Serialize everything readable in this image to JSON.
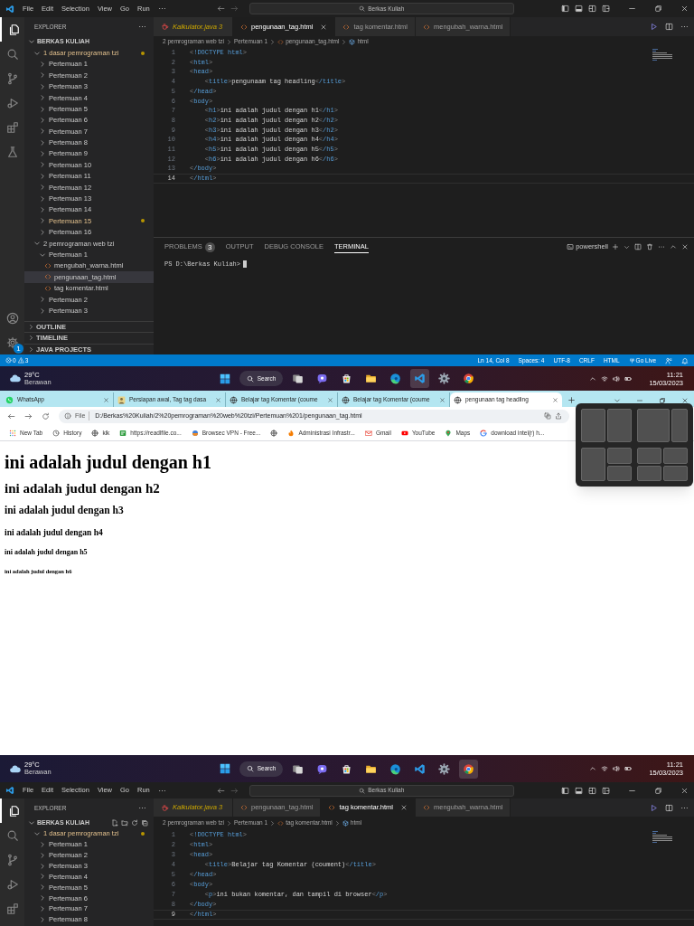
{
  "editor_top": {
    "title_bar": {
      "menu": [
        "File",
        "Edit",
        "Selection",
        "View",
        "Go",
        "Run"
      ],
      "search": "Berkas Kuliah"
    },
    "activity_bar": {
      "items": [
        {
          "kind": "files",
          "selected": true
        },
        {
          "kind": "search",
          "selected": false
        },
        {
          "kind": "source_control",
          "selected": false
        },
        {
          "kind": "run",
          "selected": false
        },
        {
          "kind": "extensions",
          "selected": false
        },
        {
          "kind": "testing",
          "selected": false
        }
      ],
      "bottom_items": [
        {
          "kind": "account"
        },
        {
          "kind": "settings",
          "badge": "1"
        }
      ]
    },
    "explorer": {
      "title": "EXPLORER",
      "root": {
        "label": "BERKAS KULIAH",
        "kind": "folder",
        "expanded": true,
        "actions_shown": false,
        "children": [
          {
            "label": "1 dasar pemrograman tzi",
            "kind": "folder",
            "expanded": true,
            "modified": true,
            "children": [
              {
                "label": "Pertemuan 1",
                "kind": "folder",
                "expanded": false,
                "modified": false
              },
              {
                "label": "Pertemuan 2",
                "kind": "folder",
                "expanded": false,
                "modified": false
              },
              {
                "label": "Pertemuan 3",
                "kind": "folder",
                "expanded": false,
                "modified": false
              },
              {
                "label": "Pertemuan 4",
                "kind": "folder",
                "expanded": false,
                "modified": false
              },
              {
                "label": "Pertemuan 5",
                "kind": "folder",
                "expanded": false,
                "modified": false
              },
              {
                "label": "Pertemuan 6",
                "kind": "folder",
                "expanded": false,
                "modified": false
              },
              {
                "label": "Pertemuan 7",
                "kind": "folder",
                "expanded": false,
                "modified": false
              },
              {
                "label": "Pertemuan 8",
                "kind": "folder",
                "expanded": false,
                "modified": false
              },
              {
                "label": "Pertemuan 9",
                "kind": "folder",
                "expanded": false,
                "modified": false
              },
              {
                "label": "Pertemuan 10",
                "kind": "folder",
                "expanded": false,
                "modified": false
              },
              {
                "label": "Pertemuan 11",
                "kind": "folder",
                "expanded": false,
                "modified": false
              },
              {
                "label": "Pertemuan 12",
                "kind": "folder",
                "expanded": false,
                "modified": false
              },
              {
                "label": "Pertemuan 13",
                "kind": "folder",
                "expanded": false,
                "modified": false
              },
              {
                "label": "Pertemuan 14",
                "kind": "folder",
                "expanded": false,
                "modified": false
              },
              {
                "label": "Pertemuan 15",
                "kind": "folder",
                "expanded": false,
                "modified": true
              },
              {
                "label": "Pertemuan 16",
                "kind": "folder",
                "expanded": false,
                "modified": false
              }
            ]
          },
          {
            "label": "2 pemrograman web tzi",
            "kind": "folder",
            "expanded": true,
            "modified": false,
            "children": [
              {
                "label": "Pertemuan 1",
                "kind": "folder",
                "expanded": true,
                "children": [
                  {
                    "label": "mengubah_warna.html",
                    "kind": "file",
                    "selected": false
                  },
                  {
                    "label": "pengunaan_tag.html",
                    "kind": "file",
                    "selected": true
                  },
                  {
                    "label": "tag komentar.html",
                    "kind": "file",
                    "selected": false
                  }
                ]
              },
              {
                "label": "Pertemuan 2",
                "kind": "folder",
                "expanded": false
              },
              {
                "label": "Pertemuan 3",
                "kind": "folder",
                "expanded": false
              }
            ]
          }
        ]
      },
      "sections": [
        "OUTLINE",
        "TIMELINE",
        "JAVA PROJECTS"
      ]
    },
    "tabs": [
      {
        "label": "Kalkulator.java",
        "kind": "java",
        "badge": "3",
        "selected": false
      },
      {
        "label": "pengunaan_tag.html",
        "kind": "html",
        "selected": true
      },
      {
        "label": "tag komentar.html",
        "kind": "html",
        "selected": false
      },
      {
        "label": "mengubah_warna.html",
        "kind": "html",
        "selected": false
      }
    ],
    "breadcrumb": [
      {
        "label": "2 pemrograman web tzi",
        "kind": "folder"
      },
      {
        "label": "Pertemuan 1",
        "kind": "folder"
      },
      {
        "label": "pengunaan_tag.html",
        "kind": "file"
      },
      {
        "label": "html",
        "kind": "element"
      }
    ],
    "code": [
      {
        "number": "1",
        "text": "<!DOCTYPE html>",
        "current": false
      },
      {
        "number": "2",
        "text": "<html>",
        "current": false
      },
      {
        "number": "3",
        "text": "<head>",
        "current": false
      },
      {
        "number": "4",
        "text": "    <title>pengunaam tag headling</title>",
        "current": false
      },
      {
        "number": "5",
        "text": "</head>",
        "current": false
      },
      {
        "number": "6",
        "text": "<body>",
        "current": false
      },
      {
        "number": "7",
        "text": "    <h1>ini adalah judul dengan h1</h1>",
        "current": false
      },
      {
        "number": "8",
        "text": "    <h2>ini adalah judul dengan h2</h2>",
        "current": false
      },
      {
        "number": "9",
        "text": "    <h3>ini adalah judul dengan h3</h2>",
        "current": false
      },
      {
        "number": "10",
        "text": "    <h4>ini adalah judul dengan h4</h4>",
        "current": false
      },
      {
        "number": "11",
        "text": "    <h5>ini adalah judul dengan h5</h5>",
        "current": false
      },
      {
        "number": "12",
        "text": "    <h6>ini adalah judul dengan h6</h6>",
        "current": false
      },
      {
        "number": "13",
        "text": "</body>",
        "current": false
      },
      {
        "number": "14",
        "text": "</html>",
        "current": true
      }
    ],
    "panel": {
      "tabs": [
        {
          "label": "PROBLEMS",
          "badge": "3",
          "selected": false
        },
        {
          "label": "OUTPUT",
          "selected": false
        },
        {
          "label": "DEBUG CONSOLE",
          "selected": false
        },
        {
          "label": "TERMINAL",
          "selected": true
        }
      ],
      "shell": "powershell",
      "terminal_lines": [
        "PS D:\\Berkas Kuliah>"
      ]
    },
    "status_bar": {
      "errors": "0",
      "warnings": "3",
      "items": [
        {
          "text": "Ln 14, Col 8",
          "kind": "plain"
        },
        {
          "text": "Spaces: 4",
          "kind": "plain"
        },
        {
          "text": "UTF-8",
          "kind": "plain"
        },
        {
          "text": "CRLF",
          "kind": "plain"
        },
        {
          "text": "HTML",
          "kind": "plain"
        },
        {
          "text": "Go Live",
          "kind": "live"
        }
      ]
    }
  },
  "taskbar_top": {
    "weather": {
      "temperature": "29°C",
      "condition": "Berawan"
    },
    "search": "Search",
    "apps": [
      {
        "kind": "taskview",
        "active": false
      },
      {
        "kind": "chat",
        "active": false
      },
      {
        "kind": "store",
        "active": false
      },
      {
        "kind": "folder",
        "active": false
      },
      {
        "kind": "edge",
        "active": false
      },
      {
        "kind": "vscode",
        "active": true
      },
      {
        "kind": "settings",
        "active": false
      },
      {
        "kind": "chrome",
        "active": false
      }
    ],
    "time": "11:21",
    "date": "15/03/2023"
  },
  "browser": {
    "tabs": [
      {
        "label": "WhatsApp",
        "kind": "whatsapp",
        "selected": false
      },
      {
        "label": "Persiapan awal, Tag tag dasa",
        "kind": "thumbnail",
        "selected": false
      },
      {
        "label": "Belajar tag Komentar (coume",
        "kind": "globe",
        "selected": false
      },
      {
        "label": "Belajar tag Komentar (coume",
        "kind": "globe",
        "selected": false
      },
      {
        "label": "pengunaan tag headling",
        "kind": "globe",
        "selected": true
      }
    ],
    "scheme": "File",
    "url": "D:/Berkas%20Kuliah/2%20pemrograman%20web%20tzi/Pertemuan%201/pengunaan_tag.html",
    "bookmarks": [
      {
        "label": "New Tab",
        "kind": "apps"
      },
      {
        "label": "History",
        "kind": "history"
      },
      {
        "label": "kik",
        "kind": "globe"
      },
      {
        "label": "https://readlfile.co...",
        "kind": "square"
      },
      {
        "label": "Browsec VPN - Free...",
        "kind": "orb"
      },
      {
        "kind": "globe"
      },
      {
        "label": "Administrasi Infrastr...",
        "kind": "flame"
      },
      {
        "label": "Gmail",
        "kind": "mail"
      },
      {
        "label": "YouTube",
        "kind": "play"
      },
      {
        "label": "Maps",
        "kind": "pin"
      },
      {
        "label": "download intel(r) h...",
        "kind": "g"
      }
    ],
    "page": {
      "headings": [
        "ini adalah judul dengan h1",
        "ini adalah judul dengan h2",
        "ini adalah judul dengan h3",
        "ini adalah judul dengan h4",
        "ini adalah judul dengan h5",
        "ini adalah judul dengan h6"
      ]
    }
  },
  "taskbar_bottom": {
    "weather": {
      "temperature": "29°C",
      "condition": "Berawan"
    },
    "search": "Search",
    "apps": [
      {
        "kind": "taskview",
        "active": false
      },
      {
        "kind": "chat",
        "active": false
      },
      {
        "kind": "store",
        "active": false
      },
      {
        "kind": "folder",
        "active": false
      },
      {
        "kind": "edge",
        "active": false
      },
      {
        "kind": "vscode",
        "active": false
      },
      {
        "kind": "settings",
        "active": false
      },
      {
        "kind": "chrome",
        "active": true
      }
    ],
    "time": "11:21",
    "date": "15/03/2023"
  },
  "editor_bottom": {
    "title_bar": {
      "menu": [
        "File",
        "Edit",
        "Selection",
        "View",
        "Go",
        "Run"
      ],
      "search": "Berkas Kuliah"
    },
    "activity_bar": {
      "items": [
        {
          "kind": "files",
          "selected": true
        },
        {
          "kind": "search",
          "selected": false
        },
        {
          "kind": "source_control",
          "selected": false
        },
        {
          "kind": "run",
          "selected": false
        },
        {
          "kind": "extensions",
          "selected": false
        }
      ]
    },
    "explorer": {
      "title": "EXPLORER",
      "root": {
        "label": "BERKAS KULIAH",
        "kind": "folder",
        "expanded": true,
        "actions_shown": true,
        "children": [
          {
            "label": "1 dasar pemrograman tzi",
            "kind": "folder",
            "expanded": true,
            "modified": true,
            "children": [
              {
                "label": "Pertemuan 1",
                "kind": "folder",
                "expanded": false,
                "modified": false
              },
              {
                "label": "Pertemuan 2",
                "kind": "folder",
                "expanded": false,
                "modified": false
              },
              {
                "label": "Pertemuan 3",
                "kind": "folder",
                "expanded": false,
                "modified": false
              },
              {
                "label": "Pertemuan 4",
                "kind": "folder",
                "expanded": false,
                "modified": false
              },
              {
                "label": "Pertemuan 5",
                "kind": "folder",
                "expanded": false,
                "modified": false
              },
              {
                "label": "Pertemuan 6",
                "kind": "folder",
                "expanded": false,
                "modified": false
              },
              {
                "label": "Pertemuan 7",
                "kind": "folder",
                "expanded": false,
                "modified": false
              },
              {
                "label": "Pertemuan 8",
                "kind": "folder",
                "expanded": false,
                "modified": false
              }
            ]
          }
        ]
      }
    },
    "tabs": [
      {
        "label": "Kalkulator.java",
        "kind": "java",
        "badge": "3",
        "selected": false
      },
      {
        "label": "pengunaan_tag.html",
        "kind": "html",
        "selected": false
      },
      {
        "label": "tag komentar.html",
        "kind": "html",
        "selected": true
      },
      {
        "label": "mengubah_warna.html",
        "kind": "html",
        "selected": false
      }
    ],
    "breadcrumb": [
      {
        "label": "2 pemrograman web tzi",
        "kind": "folder"
      },
      {
        "label": "Pertemuan 1",
        "kind": "folder"
      },
      {
        "label": "tag komentar.html",
        "kind": "file"
      },
      {
        "label": "html",
        "kind": "element"
      }
    ],
    "code": [
      {
        "number": "1",
        "text": "<!DOCTYPE html>",
        "current": false
      },
      {
        "number": "2",
        "text": "<html>",
        "current": false
      },
      {
        "number": "3",
        "text": "<head>",
        "current": false
      },
      {
        "number": "4",
        "text": "    <title>Belajar tag Komentar (coument)</title>",
        "current": false
      },
      {
        "number": "5",
        "text": "</head>",
        "current": false
      },
      {
        "number": "6",
        "text": "<body>",
        "current": false
      },
      {
        "number": "7",
        "text": "    <p>ini bukan komentar, dan tampil di browser</p>",
        "current": false
      },
      {
        "number": "8",
        "text": "</body>",
        "current": false
      },
      {
        "number": "9",
        "text": "</html>",
        "current": true
      }
    ]
  }
}
